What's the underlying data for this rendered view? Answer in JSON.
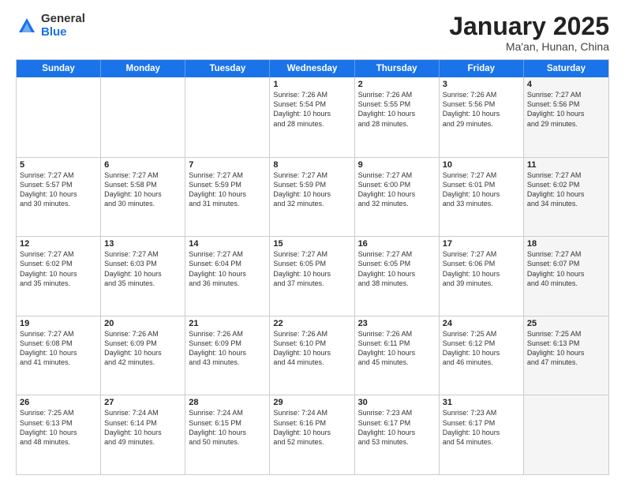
{
  "logo": {
    "general": "General",
    "blue": "Blue"
  },
  "title": {
    "month": "January 2025",
    "location": "Ma'an, Hunan, China"
  },
  "header_days": [
    "Sunday",
    "Monday",
    "Tuesday",
    "Wednesday",
    "Thursday",
    "Friday",
    "Saturday"
  ],
  "weeks": [
    [
      {
        "day": "",
        "info": "",
        "shaded": false
      },
      {
        "day": "",
        "info": "",
        "shaded": false
      },
      {
        "day": "",
        "info": "",
        "shaded": false
      },
      {
        "day": "1",
        "info": "Sunrise: 7:26 AM\nSunset: 5:54 PM\nDaylight: 10 hours\nand 28 minutes.",
        "shaded": false
      },
      {
        "day": "2",
        "info": "Sunrise: 7:26 AM\nSunset: 5:55 PM\nDaylight: 10 hours\nand 28 minutes.",
        "shaded": false
      },
      {
        "day": "3",
        "info": "Sunrise: 7:26 AM\nSunset: 5:56 PM\nDaylight: 10 hours\nand 29 minutes.",
        "shaded": false
      },
      {
        "day": "4",
        "info": "Sunrise: 7:27 AM\nSunset: 5:56 PM\nDaylight: 10 hours\nand 29 minutes.",
        "shaded": true
      }
    ],
    [
      {
        "day": "5",
        "info": "Sunrise: 7:27 AM\nSunset: 5:57 PM\nDaylight: 10 hours\nand 30 minutes.",
        "shaded": false
      },
      {
        "day": "6",
        "info": "Sunrise: 7:27 AM\nSunset: 5:58 PM\nDaylight: 10 hours\nand 30 minutes.",
        "shaded": false
      },
      {
        "day": "7",
        "info": "Sunrise: 7:27 AM\nSunset: 5:59 PM\nDaylight: 10 hours\nand 31 minutes.",
        "shaded": false
      },
      {
        "day": "8",
        "info": "Sunrise: 7:27 AM\nSunset: 5:59 PM\nDaylight: 10 hours\nand 32 minutes.",
        "shaded": false
      },
      {
        "day": "9",
        "info": "Sunrise: 7:27 AM\nSunset: 6:00 PM\nDaylight: 10 hours\nand 32 minutes.",
        "shaded": false
      },
      {
        "day": "10",
        "info": "Sunrise: 7:27 AM\nSunset: 6:01 PM\nDaylight: 10 hours\nand 33 minutes.",
        "shaded": false
      },
      {
        "day": "11",
        "info": "Sunrise: 7:27 AM\nSunset: 6:02 PM\nDaylight: 10 hours\nand 34 minutes.",
        "shaded": true
      }
    ],
    [
      {
        "day": "12",
        "info": "Sunrise: 7:27 AM\nSunset: 6:02 PM\nDaylight: 10 hours\nand 35 minutes.",
        "shaded": false
      },
      {
        "day": "13",
        "info": "Sunrise: 7:27 AM\nSunset: 6:03 PM\nDaylight: 10 hours\nand 35 minutes.",
        "shaded": false
      },
      {
        "day": "14",
        "info": "Sunrise: 7:27 AM\nSunset: 6:04 PM\nDaylight: 10 hours\nand 36 minutes.",
        "shaded": false
      },
      {
        "day": "15",
        "info": "Sunrise: 7:27 AM\nSunset: 6:05 PM\nDaylight: 10 hours\nand 37 minutes.",
        "shaded": false
      },
      {
        "day": "16",
        "info": "Sunrise: 7:27 AM\nSunset: 6:05 PM\nDaylight: 10 hours\nand 38 minutes.",
        "shaded": false
      },
      {
        "day": "17",
        "info": "Sunrise: 7:27 AM\nSunset: 6:06 PM\nDaylight: 10 hours\nand 39 minutes.",
        "shaded": false
      },
      {
        "day": "18",
        "info": "Sunrise: 7:27 AM\nSunset: 6:07 PM\nDaylight: 10 hours\nand 40 minutes.",
        "shaded": true
      }
    ],
    [
      {
        "day": "19",
        "info": "Sunrise: 7:27 AM\nSunset: 6:08 PM\nDaylight: 10 hours\nand 41 minutes.",
        "shaded": false
      },
      {
        "day": "20",
        "info": "Sunrise: 7:26 AM\nSunset: 6:09 PM\nDaylight: 10 hours\nand 42 minutes.",
        "shaded": false
      },
      {
        "day": "21",
        "info": "Sunrise: 7:26 AM\nSunset: 6:09 PM\nDaylight: 10 hours\nand 43 minutes.",
        "shaded": false
      },
      {
        "day": "22",
        "info": "Sunrise: 7:26 AM\nSunset: 6:10 PM\nDaylight: 10 hours\nand 44 minutes.",
        "shaded": false
      },
      {
        "day": "23",
        "info": "Sunrise: 7:26 AM\nSunset: 6:11 PM\nDaylight: 10 hours\nand 45 minutes.",
        "shaded": false
      },
      {
        "day": "24",
        "info": "Sunrise: 7:25 AM\nSunset: 6:12 PM\nDaylight: 10 hours\nand 46 minutes.",
        "shaded": false
      },
      {
        "day": "25",
        "info": "Sunrise: 7:25 AM\nSunset: 6:13 PM\nDaylight: 10 hours\nand 47 minutes.",
        "shaded": true
      }
    ],
    [
      {
        "day": "26",
        "info": "Sunrise: 7:25 AM\nSunset: 6:13 PM\nDaylight: 10 hours\nand 48 minutes.",
        "shaded": false
      },
      {
        "day": "27",
        "info": "Sunrise: 7:24 AM\nSunset: 6:14 PM\nDaylight: 10 hours\nand 49 minutes.",
        "shaded": false
      },
      {
        "day": "28",
        "info": "Sunrise: 7:24 AM\nSunset: 6:15 PM\nDaylight: 10 hours\nand 50 minutes.",
        "shaded": false
      },
      {
        "day": "29",
        "info": "Sunrise: 7:24 AM\nSunset: 6:16 PM\nDaylight: 10 hours\nand 52 minutes.",
        "shaded": false
      },
      {
        "day": "30",
        "info": "Sunrise: 7:23 AM\nSunset: 6:17 PM\nDaylight: 10 hours\nand 53 minutes.",
        "shaded": false
      },
      {
        "day": "31",
        "info": "Sunrise: 7:23 AM\nSunset: 6:17 PM\nDaylight: 10 hours\nand 54 minutes.",
        "shaded": false
      },
      {
        "day": "",
        "info": "",
        "shaded": true
      }
    ]
  ]
}
